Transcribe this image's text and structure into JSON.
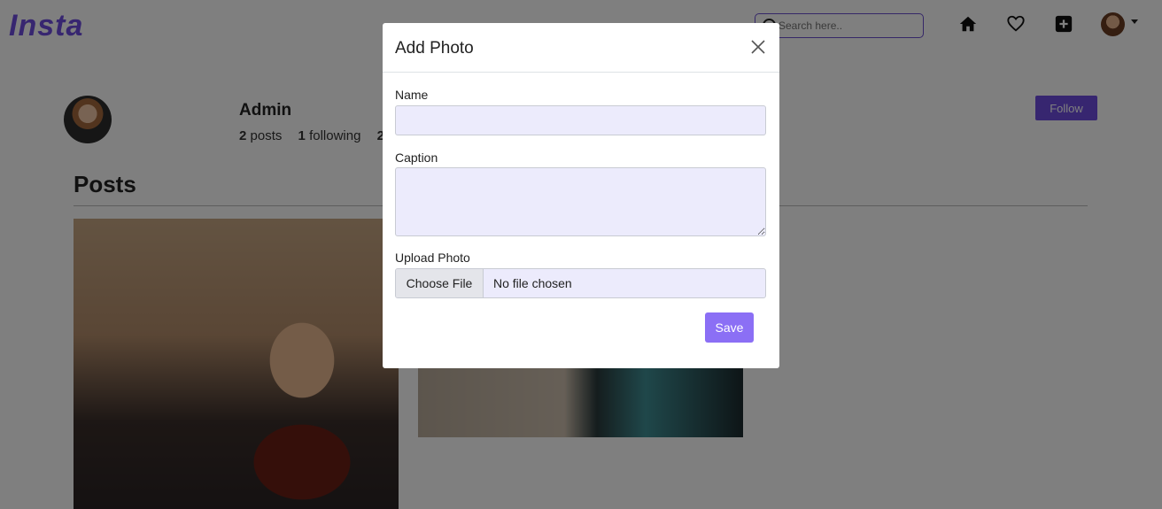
{
  "navbar": {
    "logo": "Insta",
    "search_placeholder": "Search here.."
  },
  "profile": {
    "username": "Admin",
    "posts_count": "2",
    "posts_label": "posts",
    "following_count": "1",
    "following_label": "following",
    "followers_count": "2",
    "follow_label": "Follow"
  },
  "posts_section": {
    "title": "Posts"
  },
  "modal": {
    "title": "Add Photo",
    "name_label": "Name",
    "name_value": "",
    "caption_label": "Caption",
    "caption_value": "",
    "upload_label": "Upload Photo",
    "choose_file_label": "Choose File",
    "file_status": "No file chosen",
    "save_label": "Save"
  },
  "colors": {
    "brand": "#6f4de0",
    "save_button": "#8b6ff5",
    "input_background": "#ecebfc",
    "backdrop": "rgba(0,0,0,0.5)"
  },
  "icons": [
    "search-icon",
    "home-icon",
    "heart-icon",
    "add-square-icon",
    "chevron-down-icon",
    "close-icon"
  ]
}
